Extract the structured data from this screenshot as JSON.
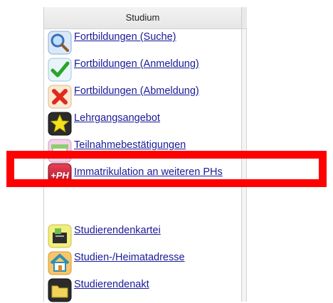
{
  "panel": {
    "header": "Studium",
    "items": [
      {
        "label": "Fortbildungen (Suche)",
        "icon": "magnifier-icon"
      },
      {
        "label": "Fortbildungen (Anmeldung)",
        "icon": "checkmark-icon"
      },
      {
        "label": "Fortbildungen (Abmeldung)",
        "icon": "red-x-icon"
      },
      {
        "label": "Lehrgangsangebot",
        "icon": "star-icon"
      },
      {
        "label": "Teilnahmebestätigungen",
        "icon": "certificate-icon"
      },
      {
        "label": "Immatrikulation an weiteren PHs",
        "icon": "plus-ph-icon",
        "icon_text": "+PH"
      },
      {
        "label": "Studierendenkartei",
        "icon": "card-file-icon"
      },
      {
        "label": "Studien-/Heimatadresse",
        "icon": "house-icon"
      },
      {
        "label": "Studierendenakt",
        "icon": "folder-icon"
      }
    ]
  },
  "colors": {
    "link": "#1a1a99",
    "highlight": "#ff0000"
  }
}
